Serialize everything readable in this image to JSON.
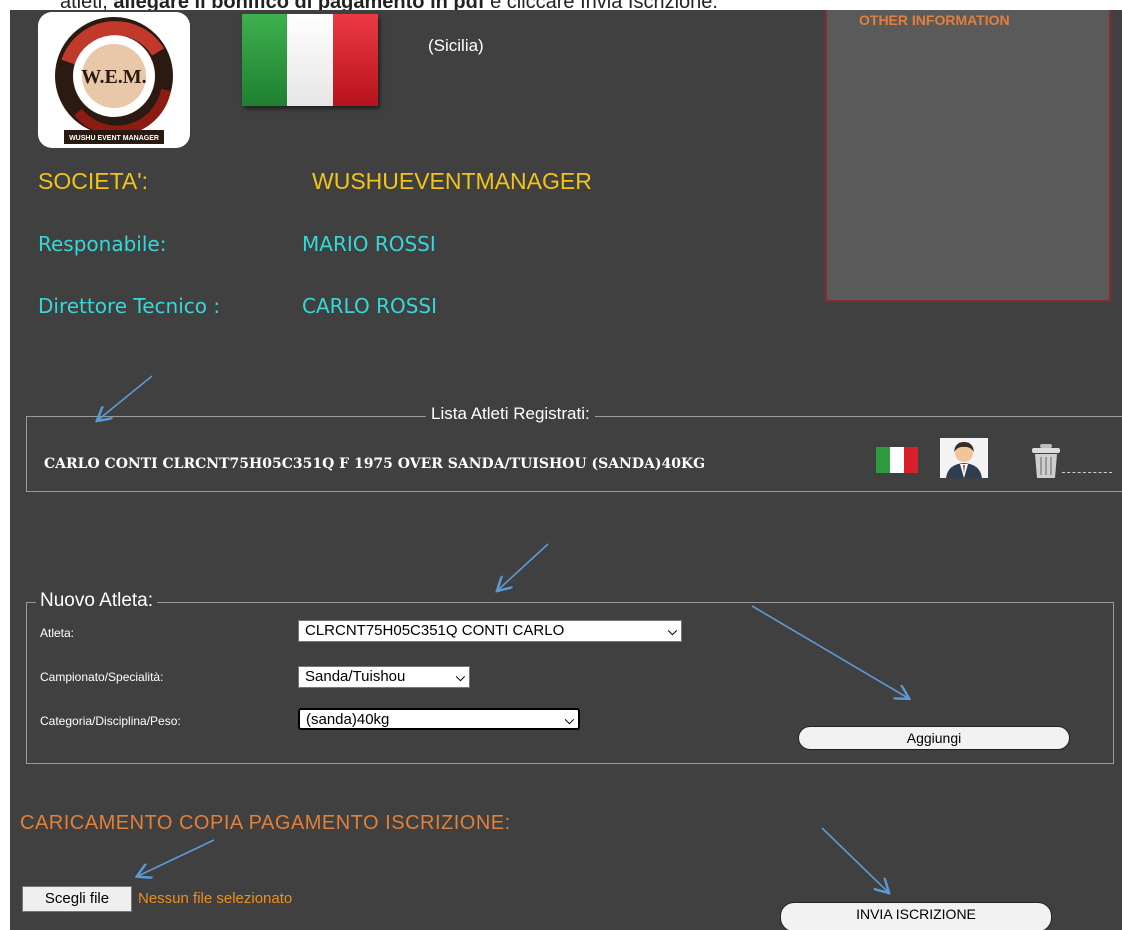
{
  "doc_text": {
    "prefix": "atleti, ",
    "bold": "allegare il bonifico di pagamento in pdf",
    "suffix": " e cliccare Invia Iscrizione."
  },
  "header": {
    "logo_text": "W.E.M.",
    "logo_caption": "WUSHU EVENT MANAGER",
    "region": "(Sicilia)",
    "other_information": "OTHER INFORMATION"
  },
  "society": {
    "label": "SOCIETA':",
    "value": "WUSHUEVENTMANAGER",
    "manager_label": "Responabile:",
    "manager_value": "MARIO ROSSI",
    "director_label": "Direttore Tecnico :",
    "director_value": "CARLO ROSSI"
  },
  "registered": {
    "legend": "Lista Atleti Registrati:",
    "rows": [
      {
        "text": "CARLO CONTI CLRCNT75H05C351Q F 1975 OVER SANDA/TUISHOU (SANDA)40KG"
      }
    ]
  },
  "new_athlete": {
    "legend": "Nuovo Atleta:",
    "athlete_label": "Atleta:",
    "athlete_value": "CLRCNT75H05C351Q CONTI CARLO",
    "championship_label": "Campionato/Specialità:",
    "championship_value": "Sanda/Tuishou",
    "category_label": "Categoria/Disciplina/Peso:",
    "category_value": "(sanda)40kg",
    "add_button": "Aggiungi"
  },
  "upload": {
    "title": "CARICAMENTO COPIA PAGAMENTO ISCRIZIONE:",
    "choose_file": "Scegli file",
    "no_file": "Nessun file selezionato",
    "submit_button": "INVIA ISCRIZIONE"
  },
  "colors": {
    "background": "#404040",
    "society": "#f0c419",
    "people": "#35d8d8",
    "upload_title": "#e0803a",
    "arrow": "#5b9bd5",
    "flag_green": "#2e9a3e",
    "flag_red": "#d8202c"
  },
  "icons": [
    "italy-flag-icon",
    "athlete-avatar-icon",
    "trash-icon"
  ]
}
